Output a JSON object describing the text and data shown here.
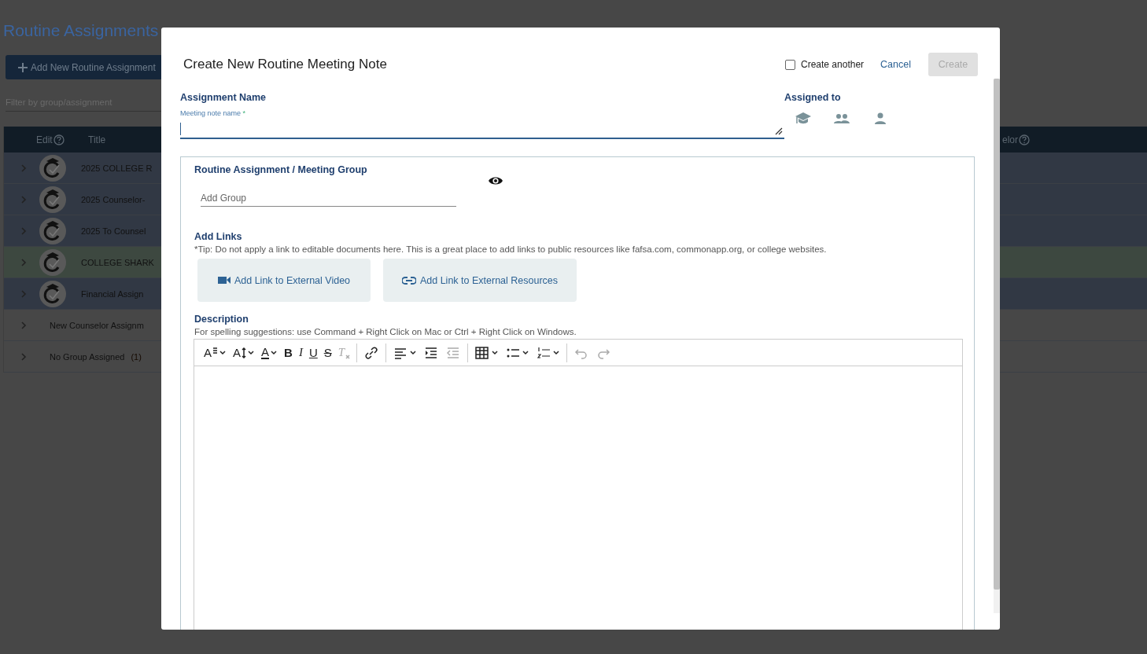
{
  "page": {
    "title": "Routine Assignments",
    "add_button": "Add New Routine Assignment",
    "filter_placeholder": "Filter by group/assignment"
  },
  "table": {
    "columns": [
      "Edit",
      "Title",
      "elor"
    ],
    "rows": [
      {
        "kind": "logo",
        "title": "2025 COLLEGE R",
        "color": "#313844"
      },
      {
        "kind": "logo",
        "title": "2025 Counselor-",
        "color": "#313844"
      },
      {
        "kind": "logo",
        "title": "2025 To Counsel",
        "color": "#313844"
      },
      {
        "kind": "logo",
        "title": "COLLEGE SHARK",
        "color": "#3d4840"
      },
      {
        "kind": "logo",
        "title": "Financial Assign",
        "color": "#313844"
      },
      {
        "kind": "plain",
        "title": "New Counselor Assignm",
        "color": "#474747"
      },
      {
        "kind": "plain",
        "title": "No Group Assigned",
        "count": "(1)",
        "color": "#474747"
      }
    ]
  },
  "dialog": {
    "title": "Create New Routine Meeting Note",
    "create_another": {
      "label": "Create another",
      "checked": false
    },
    "cancel": "Cancel",
    "create": {
      "label": "Create",
      "disabled": true
    },
    "assignment_name": {
      "label": "Assignment Name",
      "field_label": "Meeting note name",
      "required": "*"
    },
    "assigned_to": {
      "label": "Assigned to",
      "options": [
        {
          "kind": "student",
          "selected": false
        },
        {
          "kind": "group",
          "selected": false
        },
        {
          "kind": "person",
          "selected": false
        }
      ]
    },
    "group_panel": {
      "title": "Routine Assignment / Meeting Group",
      "placeholder": "Add Group",
      "links": {
        "label": "Add Links",
        "tip": "*Tip: Do not apply a link to editable documents here. This is a great place to add links to public resources like fafsa.com, commonapp.org, or college websites.",
        "buttons": [
          {
            "kind": "video",
            "label": "Add Link to External Video"
          },
          {
            "kind": "link",
            "label": "Add Link to External Resources"
          }
        ]
      },
      "description": {
        "label": "Description",
        "hint": "For spelling suggestions: use Command + Right Click on Mac or Ctrl + Right Click on Windows.",
        "toolbar": [
          [
            {
              "kind": "font-family",
              "glyph": "A",
              "dropdown": true,
              "disabled": false
            },
            {
              "kind": "font-size",
              "glyph": "A",
              "dropdown": true,
              "disabled": false
            },
            {
              "kind": "font-color",
              "glyph": "A",
              "dropdown": true,
              "disabled": false
            },
            {
              "kind": "bold",
              "glyph": "B",
              "dropdown": false,
              "disabled": false
            },
            {
              "kind": "italic",
              "glyph": "I",
              "dropdown": false,
              "disabled": false
            },
            {
              "kind": "underline",
              "glyph": "U",
              "dropdown": false,
              "disabled": false
            },
            {
              "kind": "strike",
              "glyph": "S",
              "dropdown": false,
              "disabled": false
            },
            {
              "kind": "clear",
              "glyph": "T",
              "dropdown": false,
              "disabled": true
            }
          ],
          [
            {
              "kind": "link",
              "dropdown": false,
              "disabled": false
            }
          ],
          [
            {
              "kind": "align",
              "dropdown": true,
              "disabled": false
            },
            {
              "kind": "indent",
              "dropdown": false,
              "disabled": false
            },
            {
              "kind": "outdent",
              "dropdown": false,
              "disabled": true
            }
          ],
          [
            {
              "kind": "table",
              "dropdown": true,
              "disabled": false
            },
            {
              "kind": "bullets",
              "dropdown": true,
              "disabled": false
            },
            {
              "kind": "numbers",
              "dropdown": true,
              "disabled": false
            }
          ],
          [
            {
              "kind": "undo",
              "dropdown": false,
              "disabled": true
            },
            {
              "kind": "redo",
              "dropdown": false,
              "disabled": true
            }
          ]
        ]
      }
    }
  }
}
